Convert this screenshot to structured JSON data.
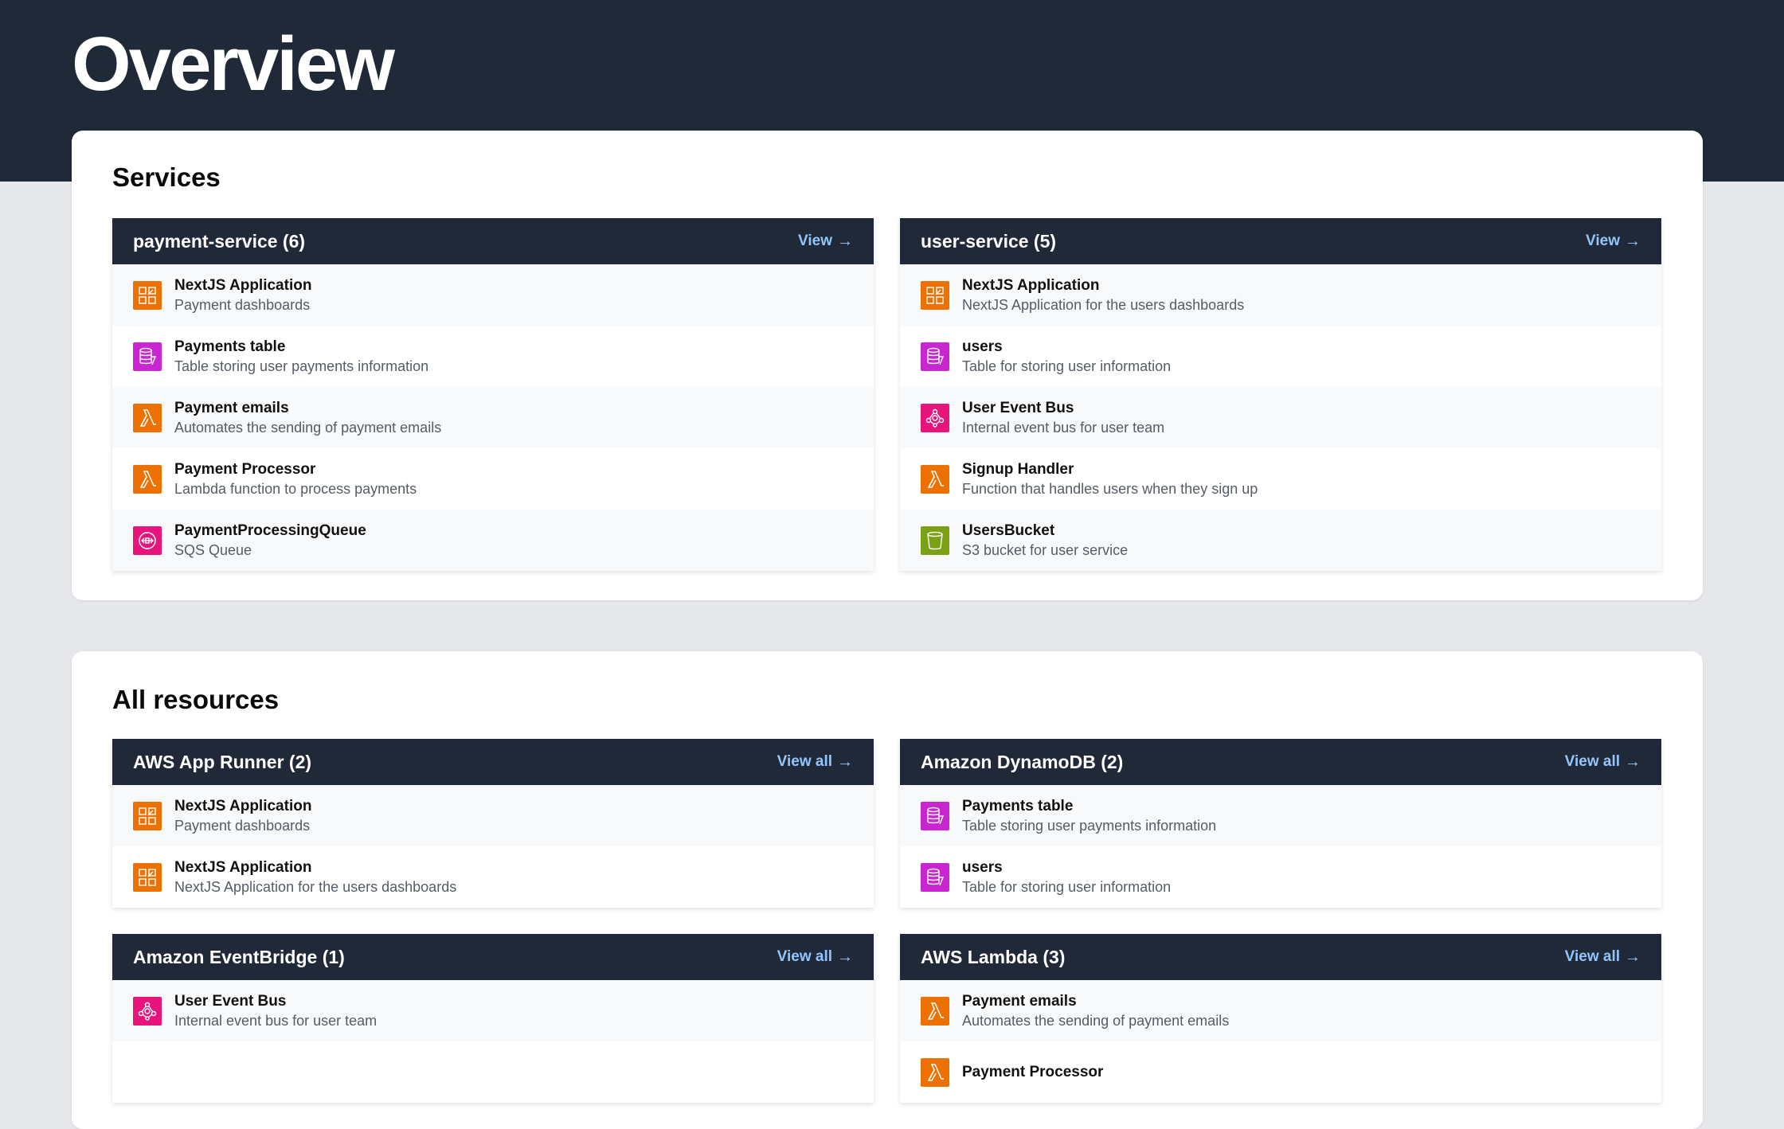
{
  "page": {
    "title": "Overview"
  },
  "colors": {
    "header_bg": "#1f2937",
    "link": "#93c5fd",
    "apprunner": "#ed7100",
    "dynamodb": "#c925d1",
    "lambda": "#ed7100",
    "sqs": "#e7157b",
    "eventbridge": "#e7157b",
    "s3": "#7aa116"
  },
  "services": {
    "title": "Services",
    "cards": [
      {
        "title": "payment-service (6)",
        "link": "View",
        "items": [
          {
            "name": "NextJS Application",
            "desc": "Payment dashboards",
            "icon": "apprunner-icon"
          },
          {
            "name": "Payments table",
            "desc": "Table storing user payments information",
            "icon": "dynamodb-icon"
          },
          {
            "name": "Payment emails",
            "desc": "Automates the sending of payment emails",
            "icon": "lambda-icon"
          },
          {
            "name": "Payment Processor",
            "desc": "Lambda function to process payments",
            "icon": "lambda-icon"
          },
          {
            "name": "PaymentProcessingQueue",
            "desc": "SQS Queue",
            "icon": "sqs-icon"
          }
        ]
      },
      {
        "title": "user-service (5)",
        "link": "View",
        "items": [
          {
            "name": "NextJS Application",
            "desc": "NextJS Application for the users dashboards",
            "icon": "apprunner-icon"
          },
          {
            "name": "users",
            "desc": "Table for storing user information",
            "icon": "dynamodb-icon"
          },
          {
            "name": "User Event Bus",
            "desc": "Internal event bus for user team",
            "icon": "eventbridge-icon"
          },
          {
            "name": "Signup Handler",
            "desc": "Function that handles users when they sign up",
            "icon": "lambda-icon"
          },
          {
            "name": "UsersBucket",
            "desc": "S3 bucket for user service",
            "icon": "s3-icon"
          }
        ]
      }
    ]
  },
  "resources": {
    "title": "All resources",
    "cards": [
      {
        "title": "AWS App Runner (2)",
        "link": "View all",
        "items": [
          {
            "name": "NextJS Application",
            "desc": "Payment dashboards",
            "icon": "apprunner-icon"
          },
          {
            "name": "NextJS Application",
            "desc": "NextJS Application for the users dashboards",
            "icon": "apprunner-icon"
          }
        ]
      },
      {
        "title": "Amazon DynamoDB (2)",
        "link": "View all",
        "items": [
          {
            "name": "Payments table",
            "desc": "Table storing user payments information",
            "icon": "dynamodb-icon"
          },
          {
            "name": "users",
            "desc": "Table for storing user information",
            "icon": "dynamodb-icon"
          }
        ]
      },
      {
        "title": "Amazon EventBridge (1)",
        "link": "View all",
        "items": [
          {
            "name": "User Event Bus",
            "desc": "Internal event bus for user team",
            "icon": "eventbridge-icon"
          }
        ]
      },
      {
        "title": "AWS Lambda (3)",
        "link": "View all",
        "items": [
          {
            "name": "Payment emails",
            "desc": "Automates the sending of payment emails",
            "icon": "lambda-icon"
          },
          {
            "name": "Payment Processor",
            "desc": "",
            "icon": "lambda-icon"
          }
        ]
      }
    ]
  }
}
